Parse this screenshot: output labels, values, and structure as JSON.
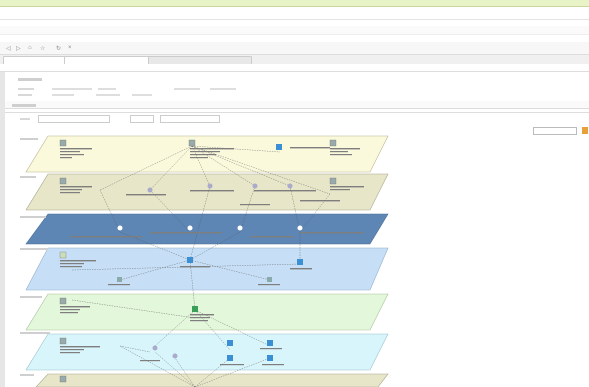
{
  "browser": {
    "tab_title": "",
    "address": "",
    "bookmark": ""
  },
  "tabs": [
    {
      "label": "",
      "active": false
    },
    {
      "label": "",
      "active": false
    },
    {
      "label": "",
      "active": true
    }
  ],
  "toolbar": {
    "icons": [
      "back-icon",
      "forward-icon",
      "home-icon",
      "star-icon",
      "refresh-icon",
      "stop-icon"
    ]
  },
  "layers": [
    {
      "label": "",
      "fill": "#fbf9dc"
    },
    {
      "label": "",
      "fill": "#e7e6c9"
    },
    {
      "label": "",
      "fill": "#5d86b4"
    },
    {
      "label": "",
      "fill": "#c7dff6"
    },
    {
      "label": "",
      "fill": "#e3f7da"
    },
    {
      "label": "",
      "fill": "#d8f5fb"
    },
    {
      "label": "",
      "fill": "#e7e6c9"
    }
  ],
  "colors": {
    "accent": "#e8a13a",
    "node_blue": "#3b8fd4",
    "node_green": "#3a9f58"
  }
}
